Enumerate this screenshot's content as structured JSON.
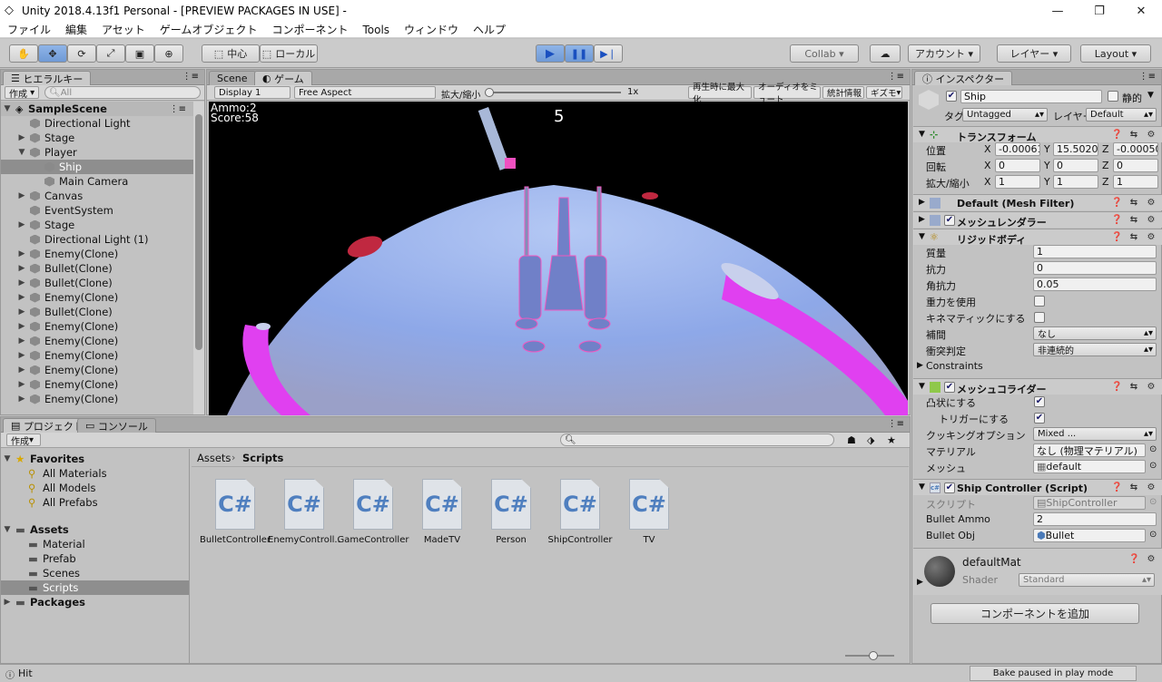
{
  "window": {
    "title": "Unity 2018.4.13f1 Personal - [PREVIEW PACKAGES IN USE] -",
    "min": "—",
    "max": "❐",
    "close": "✕"
  },
  "menu": [
    "ファイル",
    "編集",
    "アセット",
    "ゲームオブジェクト",
    "コンポーネント",
    "Tools",
    "ウィンドウ",
    "ヘルプ"
  ],
  "toolbar": {
    "center": "中心",
    "local": "ローカル",
    "collab": "Collab",
    "account": "アカウント",
    "layers": "レイヤー",
    "layout": "Layout"
  },
  "hierarchy": {
    "tab": "ヒエラルキー",
    "create": "作成",
    "search_placeholder": "All",
    "scene": "SampleScene",
    "items": [
      {
        "name": "Directional Light",
        "indent": 1,
        "arrow": ""
      },
      {
        "name": "Stage",
        "indent": 1,
        "arrow": "▶"
      },
      {
        "name": "Player",
        "indent": 1,
        "arrow": "▼"
      },
      {
        "name": "Ship",
        "indent": 2,
        "arrow": "",
        "selected": true
      },
      {
        "name": "Main Camera",
        "indent": 2,
        "arrow": ""
      },
      {
        "name": "Canvas",
        "indent": 1,
        "arrow": "▶"
      },
      {
        "name": "EventSystem",
        "indent": 1,
        "arrow": ""
      },
      {
        "name": "Stage",
        "indent": 1,
        "arrow": "▶"
      },
      {
        "name": "Directional Light (1)",
        "indent": 1,
        "arrow": ""
      },
      {
        "name": "Enemy(Clone)",
        "indent": 1,
        "arrow": "▶"
      },
      {
        "name": "Bullet(Clone)",
        "indent": 1,
        "arrow": "▶"
      },
      {
        "name": "Bullet(Clone)",
        "indent": 1,
        "arrow": "▶"
      },
      {
        "name": "Enemy(Clone)",
        "indent": 1,
        "arrow": "▶"
      },
      {
        "name": "Bullet(Clone)",
        "indent": 1,
        "arrow": "▶"
      },
      {
        "name": "Enemy(Clone)",
        "indent": 1,
        "arrow": "▶"
      },
      {
        "name": "Enemy(Clone)",
        "indent": 1,
        "arrow": "▶"
      },
      {
        "name": "Enemy(Clone)",
        "indent": 1,
        "arrow": "▶"
      },
      {
        "name": "Enemy(Clone)",
        "indent": 1,
        "arrow": "▶"
      },
      {
        "name": "Enemy(Clone)",
        "indent": 1,
        "arrow": "▶"
      },
      {
        "name": "Enemy(Clone)",
        "indent": 1,
        "arrow": "▶"
      },
      {
        "name": "Enemy(Clone)",
        "indent": 1,
        "arrow": "▶"
      }
    ]
  },
  "game": {
    "tab_scene": "Scene",
    "tab_game": "ゲーム",
    "display": "Display 1",
    "aspect": "Free Aspect",
    "scale_label": "拡大/縮小",
    "scale_value": "1x",
    "maximize": "再生時に最大化",
    "mute": "オーディオをミュート",
    "stats": "統計情報",
    "gizmos": "ギズモ",
    "hud_ammo": "Ammo:2",
    "hud_score": "Score:58",
    "hud_count": "5"
  },
  "project": {
    "tab_project": "プロジェクト",
    "tab_console": "コンソール",
    "create": "作成",
    "favorites": "Favorites",
    "fav_items": [
      "All Materials",
      "All Models",
      "All Prefabs"
    ],
    "assets": "Assets",
    "asset_folders": [
      "Material",
      "Prefab",
      "Scenes",
      "Scripts"
    ],
    "packages": "Packages",
    "breadcrumb_root": "Assets",
    "breadcrumb_leaf": "Scripts",
    "files": [
      "BulletController",
      "EnemyControll...",
      "GameController",
      "MadeTV",
      "Person",
      "ShipController",
      "TV"
    ],
    "file_glyph": "C#"
  },
  "inspector": {
    "tab": "インスペクター",
    "obj_name": "Ship",
    "static": "静的",
    "tag_label": "タグ",
    "tag": "Untagged",
    "layer_label": "レイヤー",
    "layer": "Default",
    "transform": {
      "title": "トランスフォーム",
      "pos_label": "位置",
      "rot_label": "回転",
      "scale_label": "拡大/縮小",
      "pos": {
        "x": "-0.00061",
        "y": "15.50208",
        "z": "-0.00050"
      },
      "rot": {
        "x": "0",
        "y": "0",
        "z": "0"
      },
      "scl": {
        "x": "1",
        "y": "1",
        "z": "1"
      }
    },
    "mesh_filter": "Default (Mesh Filter)",
    "mesh_renderer": "メッシュレンダラー",
    "rigidbody": {
      "title": "リジッドボディ",
      "mass_label": "質量",
      "mass": "1",
      "drag_label": "抗力",
      "drag": "0",
      "adrag_label": "角抗力",
      "adrag": "0.05",
      "gravity_label": "重力を使用",
      "kinematic_label": "キネマティックにする",
      "interp_label": "補間",
      "interp": "なし",
      "collision_label": "衝突判定",
      "collision": "非連続的",
      "constraints": "Constraints"
    },
    "mesh_collider": {
      "title": "メッシュコライダー",
      "convex_label": "凸状にする",
      "trigger_label": "トリガーにする",
      "cooking_label": "クッキングオプション",
      "cooking": "Mixed ...",
      "material_label": "マテリアル",
      "material": "なし (物理マテリアル)",
      "mesh_label": "メッシュ",
      "mesh": "default"
    },
    "script": {
      "title": "Ship Controller (Script)",
      "script_label": "スクリプト",
      "script": "ShipController",
      "ammo_label": "Bullet Ammo",
      "ammo": "2",
      "obj_label": "Bullet Obj",
      "obj": "Bullet"
    },
    "material": {
      "name": "defaultMat",
      "shader_label": "Shader",
      "shader": "Standard"
    },
    "add_component": "コンポーネントを追加"
  },
  "status": {
    "left": "Hit",
    "right": "Bake paused in play mode"
  }
}
